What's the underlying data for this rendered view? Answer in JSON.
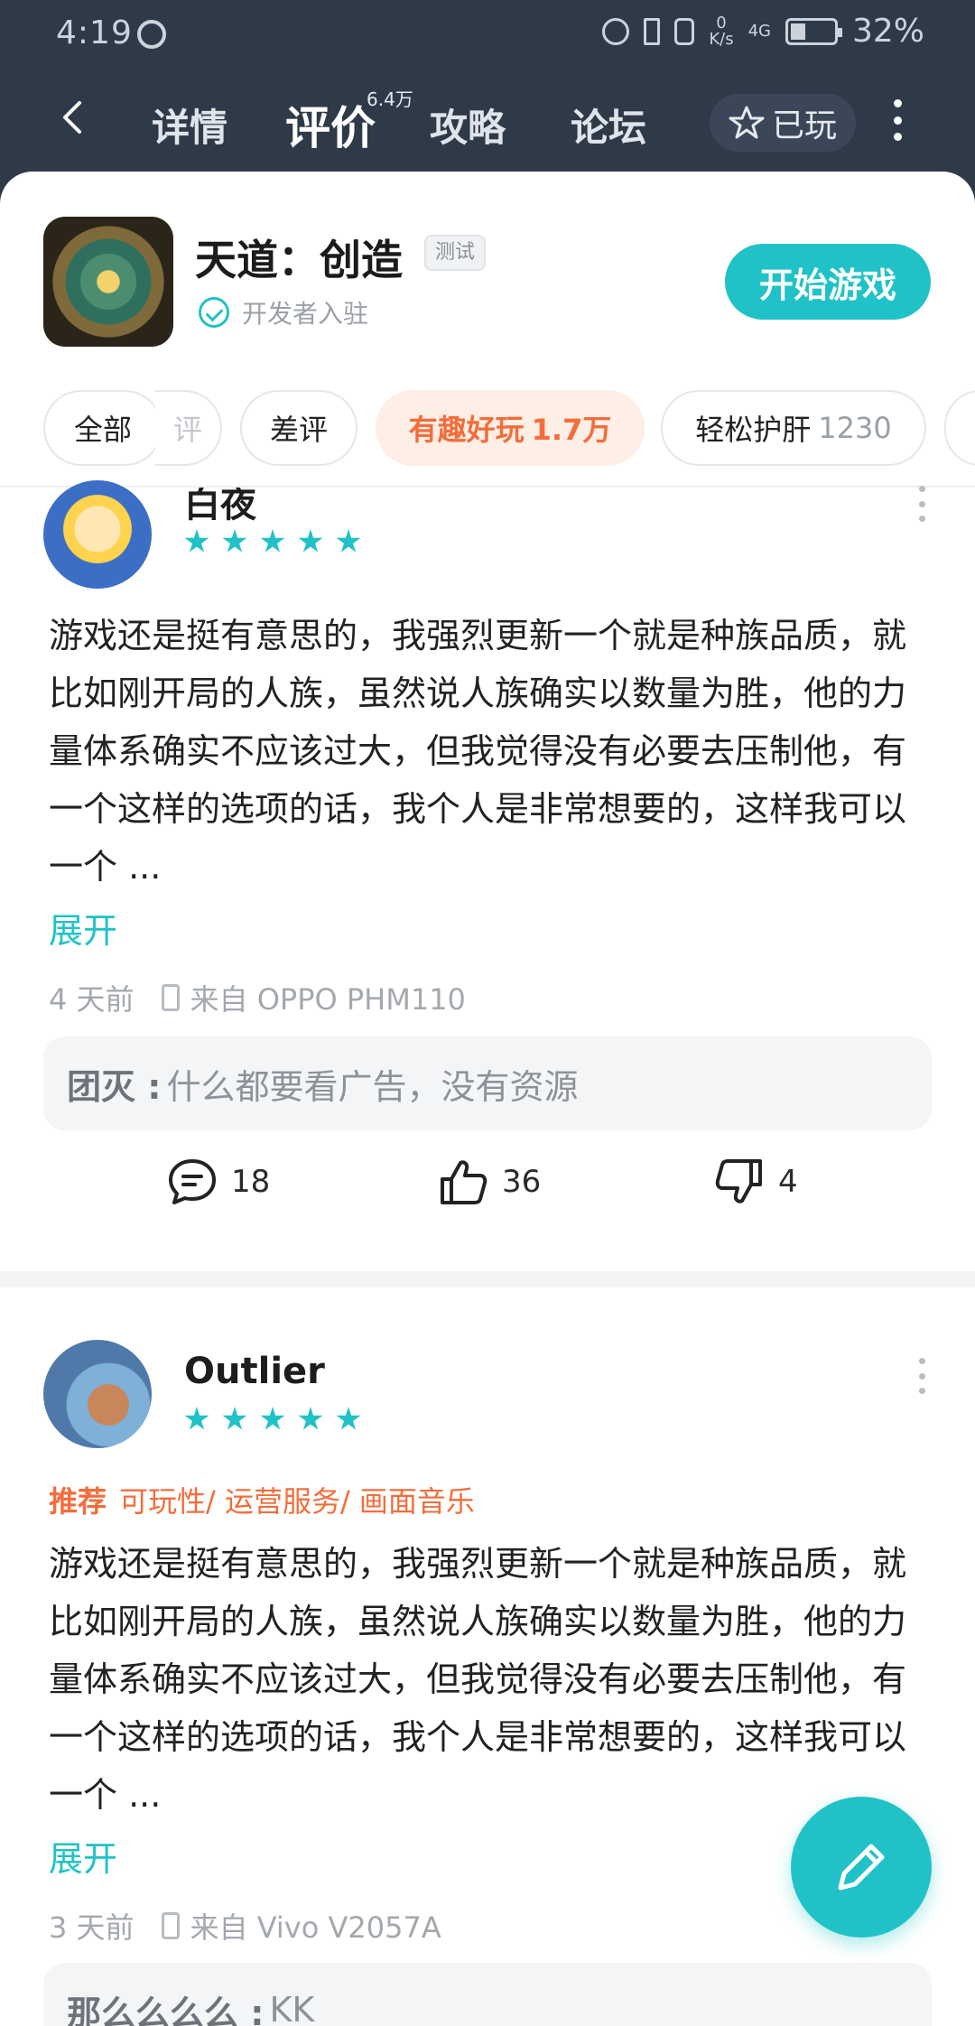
{
  "status_bar": {
    "time": "4:19",
    "net_speed_top": "0",
    "net_speed_bottom": "K/s",
    "signal_label": "4G",
    "battery": "32%"
  },
  "nav": {
    "tabs": [
      {
        "label": "详情"
      },
      {
        "label": "评价",
        "count": "6.4万"
      },
      {
        "label": "攻略"
      },
      {
        "label": "论坛"
      }
    ],
    "played_label": "已玩"
  },
  "game": {
    "title": "天道：创造",
    "badge": "测试",
    "developer_label": "开发者入驻",
    "start_button": "开始游戏"
  },
  "filters": [
    {
      "label": "全部",
      "count": ""
    },
    {
      "label": "评",
      "count": ""
    },
    {
      "label": "差评",
      "count": ""
    },
    {
      "label": "有趣好玩",
      "count": "1.7万"
    },
    {
      "label": "轻松护肝",
      "count": "1230"
    }
  ],
  "reviews": [
    {
      "username": "白夜",
      "stars": 5,
      "tags_recommend": "",
      "tags": "",
      "text": "游戏还是挺有意思的，我强烈更新一个就是种族品质，就比如刚开局的人族，虽然说人族确实以数量为胜，他的力量体系确实不应该过大，但我觉得没有必要去压制他，有一个这样的选项的话，我个人是非常想要的，这样我可以一个 ...",
      "expand": "展开",
      "time": "4 天前",
      "device": "来自 OPPO PHM110",
      "reply_name": "团灭 :",
      "reply_text": "什么都要看广告，没有资源",
      "comments": "18",
      "likes": "36",
      "dislikes": "4"
    },
    {
      "username": "Outlier",
      "stars": 5,
      "tags_recommend": "推荐",
      "tags": "可玩性/ 运营服务/ 画面音乐",
      "text": "游戏还是挺有意思的，我强烈更新一个就是种族品质，就比如刚开局的人族，虽然说人族确实以数量为胜，他的力量体系确实不应该过大，但我觉得没有必要去压制他，有一个这样的选项的话，我个人是非常想要的，这样我可以一个 ...",
      "expand": "展开",
      "time": "3 天前",
      "device": "来自 Vivo V2057A",
      "reply_name": "那么么么么 :",
      "reply_text": "KK"
    }
  ],
  "colors": {
    "accent": "#20c2c7",
    "tag_orange": "#f36d3b",
    "nav_bg": "#2f3a49"
  }
}
